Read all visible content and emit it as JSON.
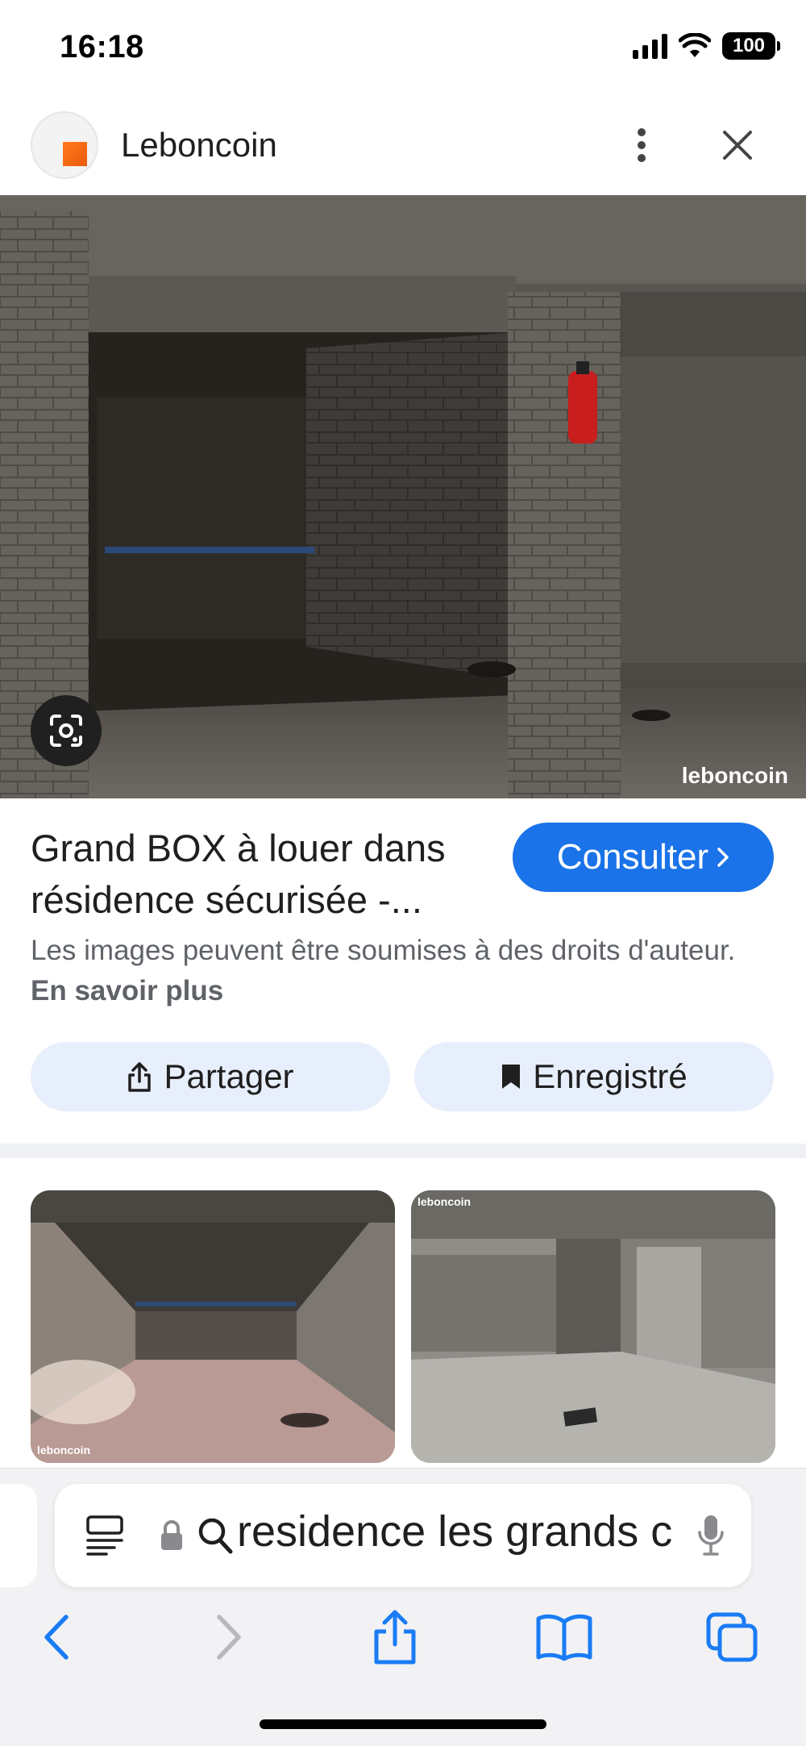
{
  "status_bar": {
    "time": "16:18",
    "battery": "100"
  },
  "header": {
    "site_name": "Leboncoin"
  },
  "main_image": {
    "watermark": "leboncoin"
  },
  "result": {
    "title_line1": "Grand BOX à louer dans",
    "title_line2": "résidence sécurisée -...",
    "consult_label": "Consulter",
    "disclaimer_text": "Les images peuvent être soumises à des droits d'auteur.",
    "learn_more": "En savoir plus",
    "share_label": "Partager",
    "saved_label": "Enregistré"
  },
  "thumbnails": [
    {
      "watermark": "leboncoin"
    },
    {
      "watermark": "leboncoin"
    }
  ],
  "address_bar": {
    "query": "residence les grands c"
  },
  "colors": {
    "accent": "#1a73e8",
    "chip_bg": "#e8effc",
    "logo": "#ea5a0c",
    "safari_blue": "#1a7cf4"
  }
}
